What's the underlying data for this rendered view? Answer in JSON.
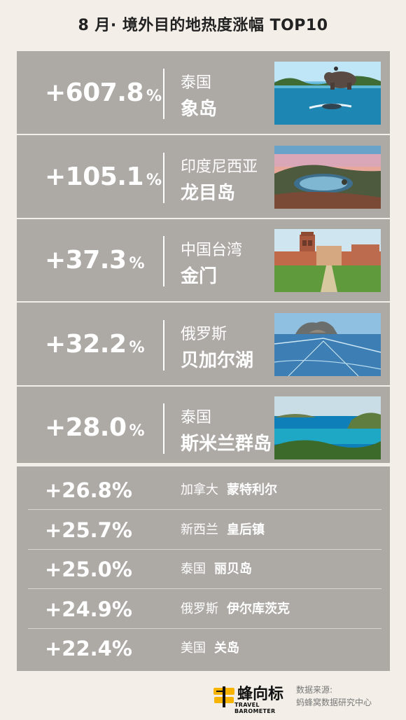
{
  "title": "8 月· 境外目的地热度涨幅 TOP10",
  "top_items": [
    {
      "pct": "+607.8",
      "sym": "%",
      "country": "泰国",
      "place": "象岛",
      "photo_icon": "elephant-beach-photo"
    },
    {
      "pct": "+105.1",
      "sym": "%",
      "country": "印度尼西亚",
      "place": "龙目岛",
      "photo_icon": "volcano-crater-photo"
    },
    {
      "pct": "+37.3",
      "sym": "%",
      "country": "中国台湾",
      "place": "金门",
      "photo_icon": "colonial-building-photo"
    },
    {
      "pct": "+32.2",
      "sym": "%",
      "country": "俄罗斯",
      "place": "贝加尔湖",
      "photo_icon": "frozen-lake-photo"
    },
    {
      "pct": "+28.0",
      "sym": "%",
      "country": "泰国",
      "place": "斯米兰群岛",
      "photo_icon": "tropical-island-photo"
    }
  ],
  "more_items": [
    {
      "pct": "+26.8%",
      "country": "加拿大",
      "place": "蒙特利尔"
    },
    {
      "pct": "+25.7%",
      "country": "新西兰",
      "place": "皇后镇"
    },
    {
      "pct": "+25.0%",
      "country": "泰国",
      "place": "丽贝岛"
    },
    {
      "pct": "+24.9%",
      "country": "俄罗斯",
      "place": "伊尔库茨克"
    },
    {
      "pct": "+22.4%",
      "country": "美国",
      "place": "关岛"
    }
  ],
  "footer": {
    "logo_text": "蜂向标",
    "logo_sub": "TRAVEL BAROMETER",
    "source_label": "数据来源:",
    "source_name": "蚂蜂窝数据研究中心"
  },
  "colors": {
    "background": "#f3efe8",
    "block": "#adaaa6",
    "text": "#ffffff"
  }
}
